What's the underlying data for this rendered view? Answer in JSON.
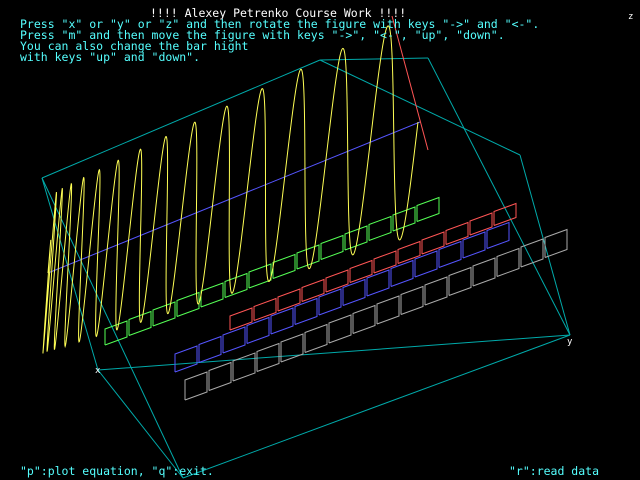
{
  "title": "!!!! Alexey Petrenko Course Work !!!!",
  "instructions": [
    "Press \"x\" or \"y\" or \"z\" and then rotate the figure with keys \"->\" and \"<-\".",
    "Press \"m\" and then move the figure with keys \"->\", \"<-\", \"up\", \"down\".",
    "You can also change the bar hight",
    "with keys \"up\" and \"down\"."
  ],
  "footer": {
    "left": "\"p\":plot equation, \"q\":exit.",
    "right": "\"r\":read data"
  },
  "axis_labels": {
    "x": "x",
    "y": "y",
    "z": "z"
  },
  "colors": {
    "background": "#000000",
    "title": "#ffffff",
    "text": "#55ffff",
    "box_frame": "#00aaaa",
    "sine_wave": "#ffff55",
    "midline": "#5555ff",
    "red_axis": "#ff5555",
    "bars_green": "#55ff55",
    "bars_red": "#ff5555",
    "bars_blue": "#5555ff",
    "bars_gray": "#aaaaaa"
  }
}
